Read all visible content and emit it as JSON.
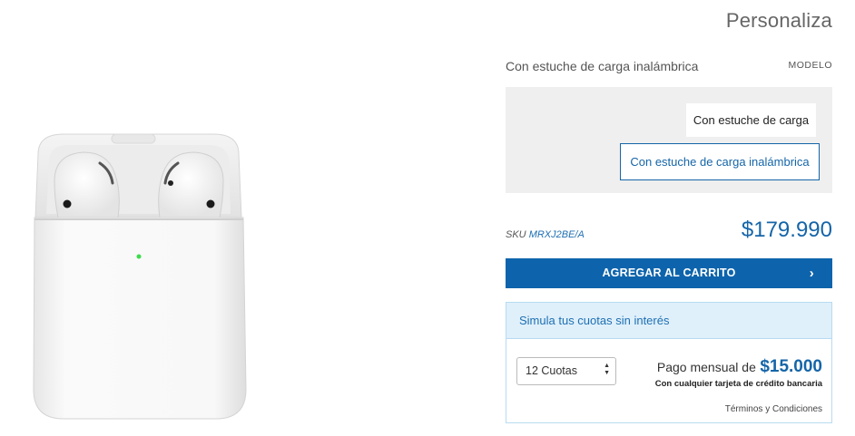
{
  "header": {
    "title": "Personaliza"
  },
  "model": {
    "selected": "Con estuche de carga inalámbrica",
    "label": "MODELO",
    "options": [
      "Con estuche de carga",
      "Con estuche de carga inalámbrica"
    ]
  },
  "product": {
    "sku_label": "SKU",
    "sku_code": "MRXJ2BE/A",
    "price": "$179.990"
  },
  "cart": {
    "button_label": "AGREGAR AL CARRITO"
  },
  "installments": {
    "header": "Simula tus cuotas sin interés",
    "select_value": "12 Cuotas",
    "monthly_label": "Pago mensual de",
    "monthly_value": "$15.000",
    "card_note": "Con cualquier tarjeta de crédito bancaria",
    "terms": "Términos y Condiciones"
  },
  "colors": {
    "brand_blue": "#0d64ac",
    "price_blue": "#1565a8",
    "info_bg": "#dff0fb",
    "led_green": "#3ddc4b"
  },
  "icons": {
    "cart_arrow": "chevron-right-icon",
    "select_arrows": "select-updown-icon"
  }
}
